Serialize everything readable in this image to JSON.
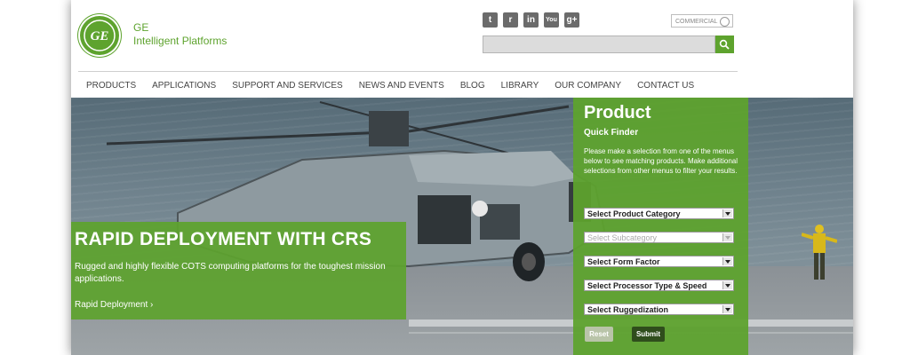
{
  "brand": {
    "line1": "GE",
    "line2": "Intelligent Platforms"
  },
  "social": [
    {
      "icon": "twitter-icon",
      "glyph": "t"
    },
    {
      "icon": "rss-icon",
      "glyph": "r"
    },
    {
      "icon": "linkedin-icon",
      "glyph": "in"
    },
    {
      "icon": "youtube-icon",
      "glyph": "You"
    },
    {
      "icon": "googleplus-icon",
      "glyph": "g+"
    }
  ],
  "header": {
    "commercial_label": "COMMERCIAL",
    "search_value": ""
  },
  "nav": [
    "PRODUCTS",
    "APPLICATIONS",
    "SUPPORT AND SERVICES",
    "NEWS AND EVENTS",
    "BLOG",
    "LIBRARY",
    "OUR COMPANY",
    "CONTACT US"
  ],
  "promo": {
    "title": "RAPID DEPLOYMENT WITH CRS",
    "text": "Rugged and highly flexible COTS computing platforms for the toughest mission applications.",
    "link": "Rapid Deployment ›"
  },
  "finder": {
    "title": "Product",
    "subtitle": "Quick Finder",
    "description": "Please make a selection from one of the menus below to see matching products. Make additional selections from other menus to filter your results.",
    "selects": [
      {
        "label": "Select Product Category",
        "disabled": false
      },
      {
        "label": "Select Subcategory",
        "disabled": true
      },
      {
        "label": "Select Form Factor",
        "disabled": false
      },
      {
        "label": "Select Processor Type & Speed",
        "disabled": false
      },
      {
        "label": "Select Ruggedization",
        "disabled": false
      }
    ],
    "reset_label": "Reset",
    "submit_label": "Submit"
  },
  "colors": {
    "accent": "#5ea32e",
    "submit": "#2f4d1c"
  }
}
